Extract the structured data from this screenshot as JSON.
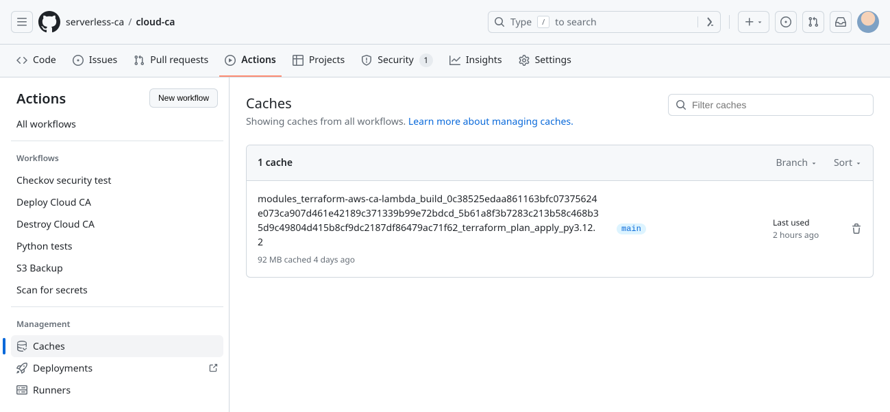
{
  "header": {
    "owner": "serverless-ca",
    "repo": "cloud-ca",
    "search_placeholder_pre": "Type ",
    "search_kbd": "/",
    "search_placeholder_post": " to search"
  },
  "repo_tabs": {
    "code": "Code",
    "issues": "Issues",
    "pull_requests": "Pull requests",
    "actions": "Actions",
    "projects": "Projects",
    "security": "Security",
    "security_count": "1",
    "insights": "Insights",
    "settings": "Settings"
  },
  "sidebar": {
    "title": "Actions",
    "new_workflow": "New workflow",
    "all_workflows": "All workflows",
    "workflows_label": "Workflows",
    "workflows": [
      "Checkov security test",
      "Deploy Cloud CA",
      "Destroy Cloud CA",
      "Python tests",
      "S3 Backup",
      "Scan for secrets"
    ],
    "management_label": "Management",
    "management": {
      "caches": "Caches",
      "deployments": "Deployments",
      "runners": "Runners"
    }
  },
  "page": {
    "title": "Caches",
    "subhead_text": "Showing caches from all workflows. ",
    "subhead_link": "Learn more about managing caches.",
    "filter_placeholder": "Filter caches",
    "count_label": "1 cache",
    "branch_dd": "Branch",
    "sort_dd": "Sort"
  },
  "cache": {
    "name": "modules_terraform-aws-ca-lambda_build_0c38525edaa861163bfc07375624e073ca907d461e42189c371339b99e72bdcd_5b61a8f3b7283c213b58c468b35d9c49804d415b8cf9dc2187df86479ac71f62_terraform_plan_apply_py3.12.2",
    "meta": "92 MB cached 4 days ago",
    "branch": "main",
    "last_used_label": "Last used",
    "last_used_time": "2 hours ago"
  }
}
